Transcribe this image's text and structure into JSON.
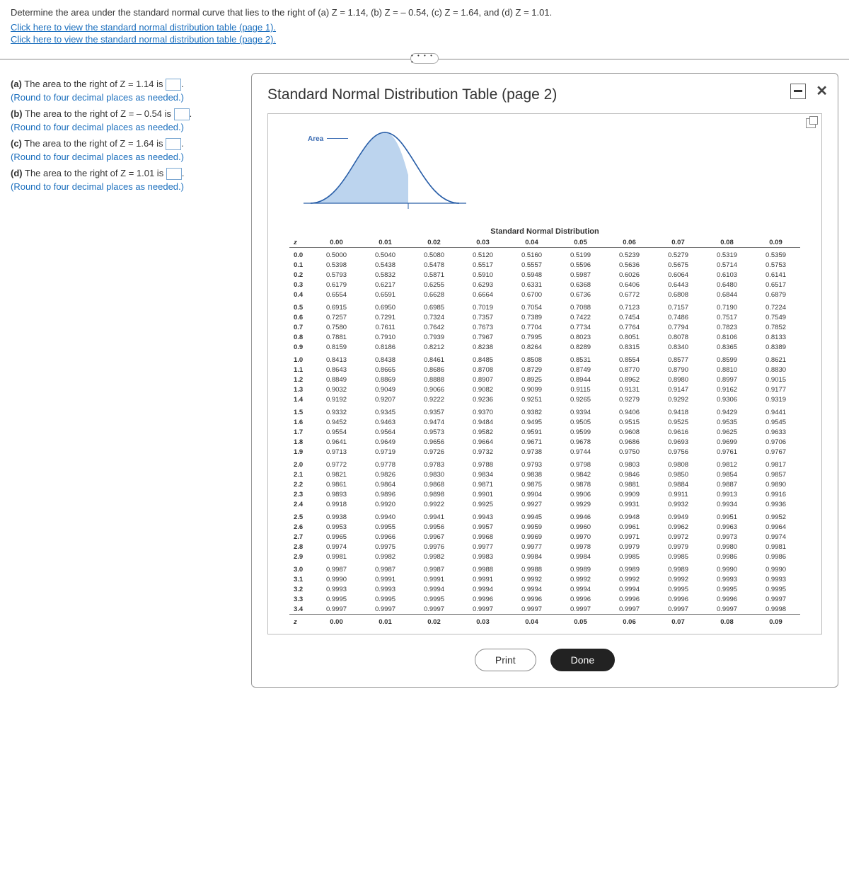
{
  "question": "Determine the area under the standard normal curve that lies to the right of (a) Z = 1.14, (b) Z = – 0.54, (c) Z = 1.64, and (d) Z = 1.01.",
  "links": {
    "page1": "Click here to view the standard normal distribution table (page 1).",
    "page2": "Click here to view the standard normal distribution table (page 2)."
  },
  "expand_label": "• • • • •",
  "parts": {
    "a": {
      "prefix": "(a)",
      "text": "The area to the right of Z = 1.14 is",
      "suffix": ".",
      "note": "(Round to four decimal places as needed.)"
    },
    "b": {
      "prefix": "(b)",
      "text": "The area to the right of Z = – 0.54 is",
      "suffix": ".",
      "note": "(Round to four decimal places as needed.)"
    },
    "c": {
      "prefix": "(c)",
      "text": "The area to the right of Z = 1.64 is",
      "suffix": ".",
      "note": "(Round to four decimal places as needed.)"
    },
    "d": {
      "prefix": "(d)",
      "text": "The area to the right of Z = 1.01 is",
      "suffix": ".",
      "note": "(Round to four decimal places as needed.)"
    }
  },
  "modal": {
    "title": "Standard Normal Distribution Table (page 2)",
    "area_label": "Area",
    "z_label": "z",
    "dist_title": "Standard Normal Distribution",
    "print": "Print",
    "done": "Done"
  },
  "chart_data": {
    "type": "table",
    "title": "Standard Normal Distribution",
    "col_headers": [
      "z",
      "0.00",
      "0.01",
      "0.02",
      "0.03",
      "0.04",
      "0.05",
      "0.06",
      "0.07",
      "0.08",
      "0.09"
    ],
    "rows": [
      {
        "z": "0.0",
        "v": [
          "0.5000",
          "0.5040",
          "0.5080",
          "0.5120",
          "0.5160",
          "0.5199",
          "0.5239",
          "0.5279",
          "0.5319",
          "0.5359"
        ]
      },
      {
        "z": "0.1",
        "v": [
          "0.5398",
          "0.5438",
          "0.5478",
          "0.5517",
          "0.5557",
          "0.5596",
          "0.5636",
          "0.5675",
          "0.5714",
          "0.5753"
        ]
      },
      {
        "z": "0.2",
        "v": [
          "0.5793",
          "0.5832",
          "0.5871",
          "0.5910",
          "0.5948",
          "0.5987",
          "0.6026",
          "0.6064",
          "0.6103",
          "0.6141"
        ]
      },
      {
        "z": "0.3",
        "v": [
          "0.6179",
          "0.6217",
          "0.6255",
          "0.6293",
          "0.6331",
          "0.6368",
          "0.6406",
          "0.6443",
          "0.6480",
          "0.6517"
        ]
      },
      {
        "z": "0.4",
        "v": [
          "0.6554",
          "0.6591",
          "0.6628",
          "0.6664",
          "0.6700",
          "0.6736",
          "0.6772",
          "0.6808",
          "0.6844",
          "0.6879"
        ]
      },
      {
        "z": "0.5",
        "v": [
          "0.6915",
          "0.6950",
          "0.6985",
          "0.7019",
          "0.7054",
          "0.7088",
          "0.7123",
          "0.7157",
          "0.7190",
          "0.7224"
        ]
      },
      {
        "z": "0.6",
        "v": [
          "0.7257",
          "0.7291",
          "0.7324",
          "0.7357",
          "0.7389",
          "0.7422",
          "0.7454",
          "0.7486",
          "0.7517",
          "0.7549"
        ]
      },
      {
        "z": "0.7",
        "v": [
          "0.7580",
          "0.7611",
          "0.7642",
          "0.7673",
          "0.7704",
          "0.7734",
          "0.7764",
          "0.7794",
          "0.7823",
          "0.7852"
        ]
      },
      {
        "z": "0.8",
        "v": [
          "0.7881",
          "0.7910",
          "0.7939",
          "0.7967",
          "0.7995",
          "0.8023",
          "0.8051",
          "0.8078",
          "0.8106",
          "0.8133"
        ]
      },
      {
        "z": "0.9",
        "v": [
          "0.8159",
          "0.8186",
          "0.8212",
          "0.8238",
          "0.8264",
          "0.8289",
          "0.8315",
          "0.8340",
          "0.8365",
          "0.8389"
        ]
      },
      {
        "z": "1.0",
        "v": [
          "0.8413",
          "0.8438",
          "0.8461",
          "0.8485",
          "0.8508",
          "0.8531",
          "0.8554",
          "0.8577",
          "0.8599",
          "0.8621"
        ]
      },
      {
        "z": "1.1",
        "v": [
          "0.8643",
          "0.8665",
          "0.8686",
          "0.8708",
          "0.8729",
          "0.8749",
          "0.8770",
          "0.8790",
          "0.8810",
          "0.8830"
        ]
      },
      {
        "z": "1.2",
        "v": [
          "0.8849",
          "0.8869",
          "0.8888",
          "0.8907",
          "0.8925",
          "0.8944",
          "0.8962",
          "0.8980",
          "0.8997",
          "0.9015"
        ]
      },
      {
        "z": "1.3",
        "v": [
          "0.9032",
          "0.9049",
          "0.9066",
          "0.9082",
          "0.9099",
          "0.9115",
          "0.9131",
          "0.9147",
          "0.9162",
          "0.9177"
        ]
      },
      {
        "z": "1.4",
        "v": [
          "0.9192",
          "0.9207",
          "0.9222",
          "0.9236",
          "0.9251",
          "0.9265",
          "0.9279",
          "0.9292",
          "0.9306",
          "0.9319"
        ]
      },
      {
        "z": "1.5",
        "v": [
          "0.9332",
          "0.9345",
          "0.9357",
          "0.9370",
          "0.9382",
          "0.9394",
          "0.9406",
          "0.9418",
          "0.9429",
          "0.9441"
        ]
      },
      {
        "z": "1.6",
        "v": [
          "0.9452",
          "0.9463",
          "0.9474",
          "0.9484",
          "0.9495",
          "0.9505",
          "0.9515",
          "0.9525",
          "0.9535",
          "0.9545"
        ]
      },
      {
        "z": "1.7",
        "v": [
          "0.9554",
          "0.9564",
          "0.9573",
          "0.9582",
          "0.9591",
          "0.9599",
          "0.9608",
          "0.9616",
          "0.9625",
          "0.9633"
        ]
      },
      {
        "z": "1.8",
        "v": [
          "0.9641",
          "0.9649",
          "0.9656",
          "0.9664",
          "0.9671",
          "0.9678",
          "0.9686",
          "0.9693",
          "0.9699",
          "0.9706"
        ]
      },
      {
        "z": "1.9",
        "v": [
          "0.9713",
          "0.9719",
          "0.9726",
          "0.9732",
          "0.9738",
          "0.9744",
          "0.9750",
          "0.9756",
          "0.9761",
          "0.9767"
        ]
      },
      {
        "z": "2.0",
        "v": [
          "0.9772",
          "0.9778",
          "0.9783",
          "0.9788",
          "0.9793",
          "0.9798",
          "0.9803",
          "0.9808",
          "0.9812",
          "0.9817"
        ]
      },
      {
        "z": "2.1",
        "v": [
          "0.9821",
          "0.9826",
          "0.9830",
          "0.9834",
          "0.9838",
          "0.9842",
          "0.9846",
          "0.9850",
          "0.9854",
          "0.9857"
        ]
      },
      {
        "z": "2.2",
        "v": [
          "0.9861",
          "0.9864",
          "0.9868",
          "0.9871",
          "0.9875",
          "0.9878",
          "0.9881",
          "0.9884",
          "0.9887",
          "0.9890"
        ]
      },
      {
        "z": "2.3",
        "v": [
          "0.9893",
          "0.9896",
          "0.9898",
          "0.9901",
          "0.9904",
          "0.9906",
          "0.9909",
          "0.9911",
          "0.9913",
          "0.9916"
        ]
      },
      {
        "z": "2.4",
        "v": [
          "0.9918",
          "0.9920",
          "0.9922",
          "0.9925",
          "0.9927",
          "0.9929",
          "0.9931",
          "0.9932",
          "0.9934",
          "0.9936"
        ]
      },
      {
        "z": "2.5",
        "v": [
          "0.9938",
          "0.9940",
          "0.9941",
          "0.9943",
          "0.9945",
          "0.9946",
          "0.9948",
          "0.9949",
          "0.9951",
          "0.9952"
        ]
      },
      {
        "z": "2.6",
        "v": [
          "0.9953",
          "0.9955",
          "0.9956",
          "0.9957",
          "0.9959",
          "0.9960",
          "0.9961",
          "0.9962",
          "0.9963",
          "0.9964"
        ]
      },
      {
        "z": "2.7",
        "v": [
          "0.9965",
          "0.9966",
          "0.9967",
          "0.9968",
          "0.9969",
          "0.9970",
          "0.9971",
          "0.9972",
          "0.9973",
          "0.9974"
        ]
      },
      {
        "z": "2.8",
        "v": [
          "0.9974",
          "0.9975",
          "0.9976",
          "0.9977",
          "0.9977",
          "0.9978",
          "0.9979",
          "0.9979",
          "0.9980",
          "0.9981"
        ]
      },
      {
        "z": "2.9",
        "v": [
          "0.9981",
          "0.9982",
          "0.9982",
          "0.9983",
          "0.9984",
          "0.9984",
          "0.9985",
          "0.9985",
          "0.9986",
          "0.9986"
        ]
      },
      {
        "z": "3.0",
        "v": [
          "0.9987",
          "0.9987",
          "0.9987",
          "0.9988",
          "0.9988",
          "0.9989",
          "0.9989",
          "0.9989",
          "0.9990",
          "0.9990"
        ]
      },
      {
        "z": "3.1",
        "v": [
          "0.9990",
          "0.9991",
          "0.9991",
          "0.9991",
          "0.9992",
          "0.9992",
          "0.9992",
          "0.9992",
          "0.9993",
          "0.9993"
        ]
      },
      {
        "z": "3.2",
        "v": [
          "0.9993",
          "0.9993",
          "0.9994",
          "0.9994",
          "0.9994",
          "0.9994",
          "0.9994",
          "0.9995",
          "0.9995",
          "0.9995"
        ]
      },
      {
        "z": "3.3",
        "v": [
          "0.9995",
          "0.9995",
          "0.9995",
          "0.9996",
          "0.9996",
          "0.9996",
          "0.9996",
          "0.9996",
          "0.9996",
          "0.9997"
        ]
      },
      {
        "z": "3.4",
        "v": [
          "0.9997",
          "0.9997",
          "0.9997",
          "0.9997",
          "0.9997",
          "0.9997",
          "0.9997",
          "0.9997",
          "0.9997",
          "0.9998"
        ]
      }
    ]
  }
}
